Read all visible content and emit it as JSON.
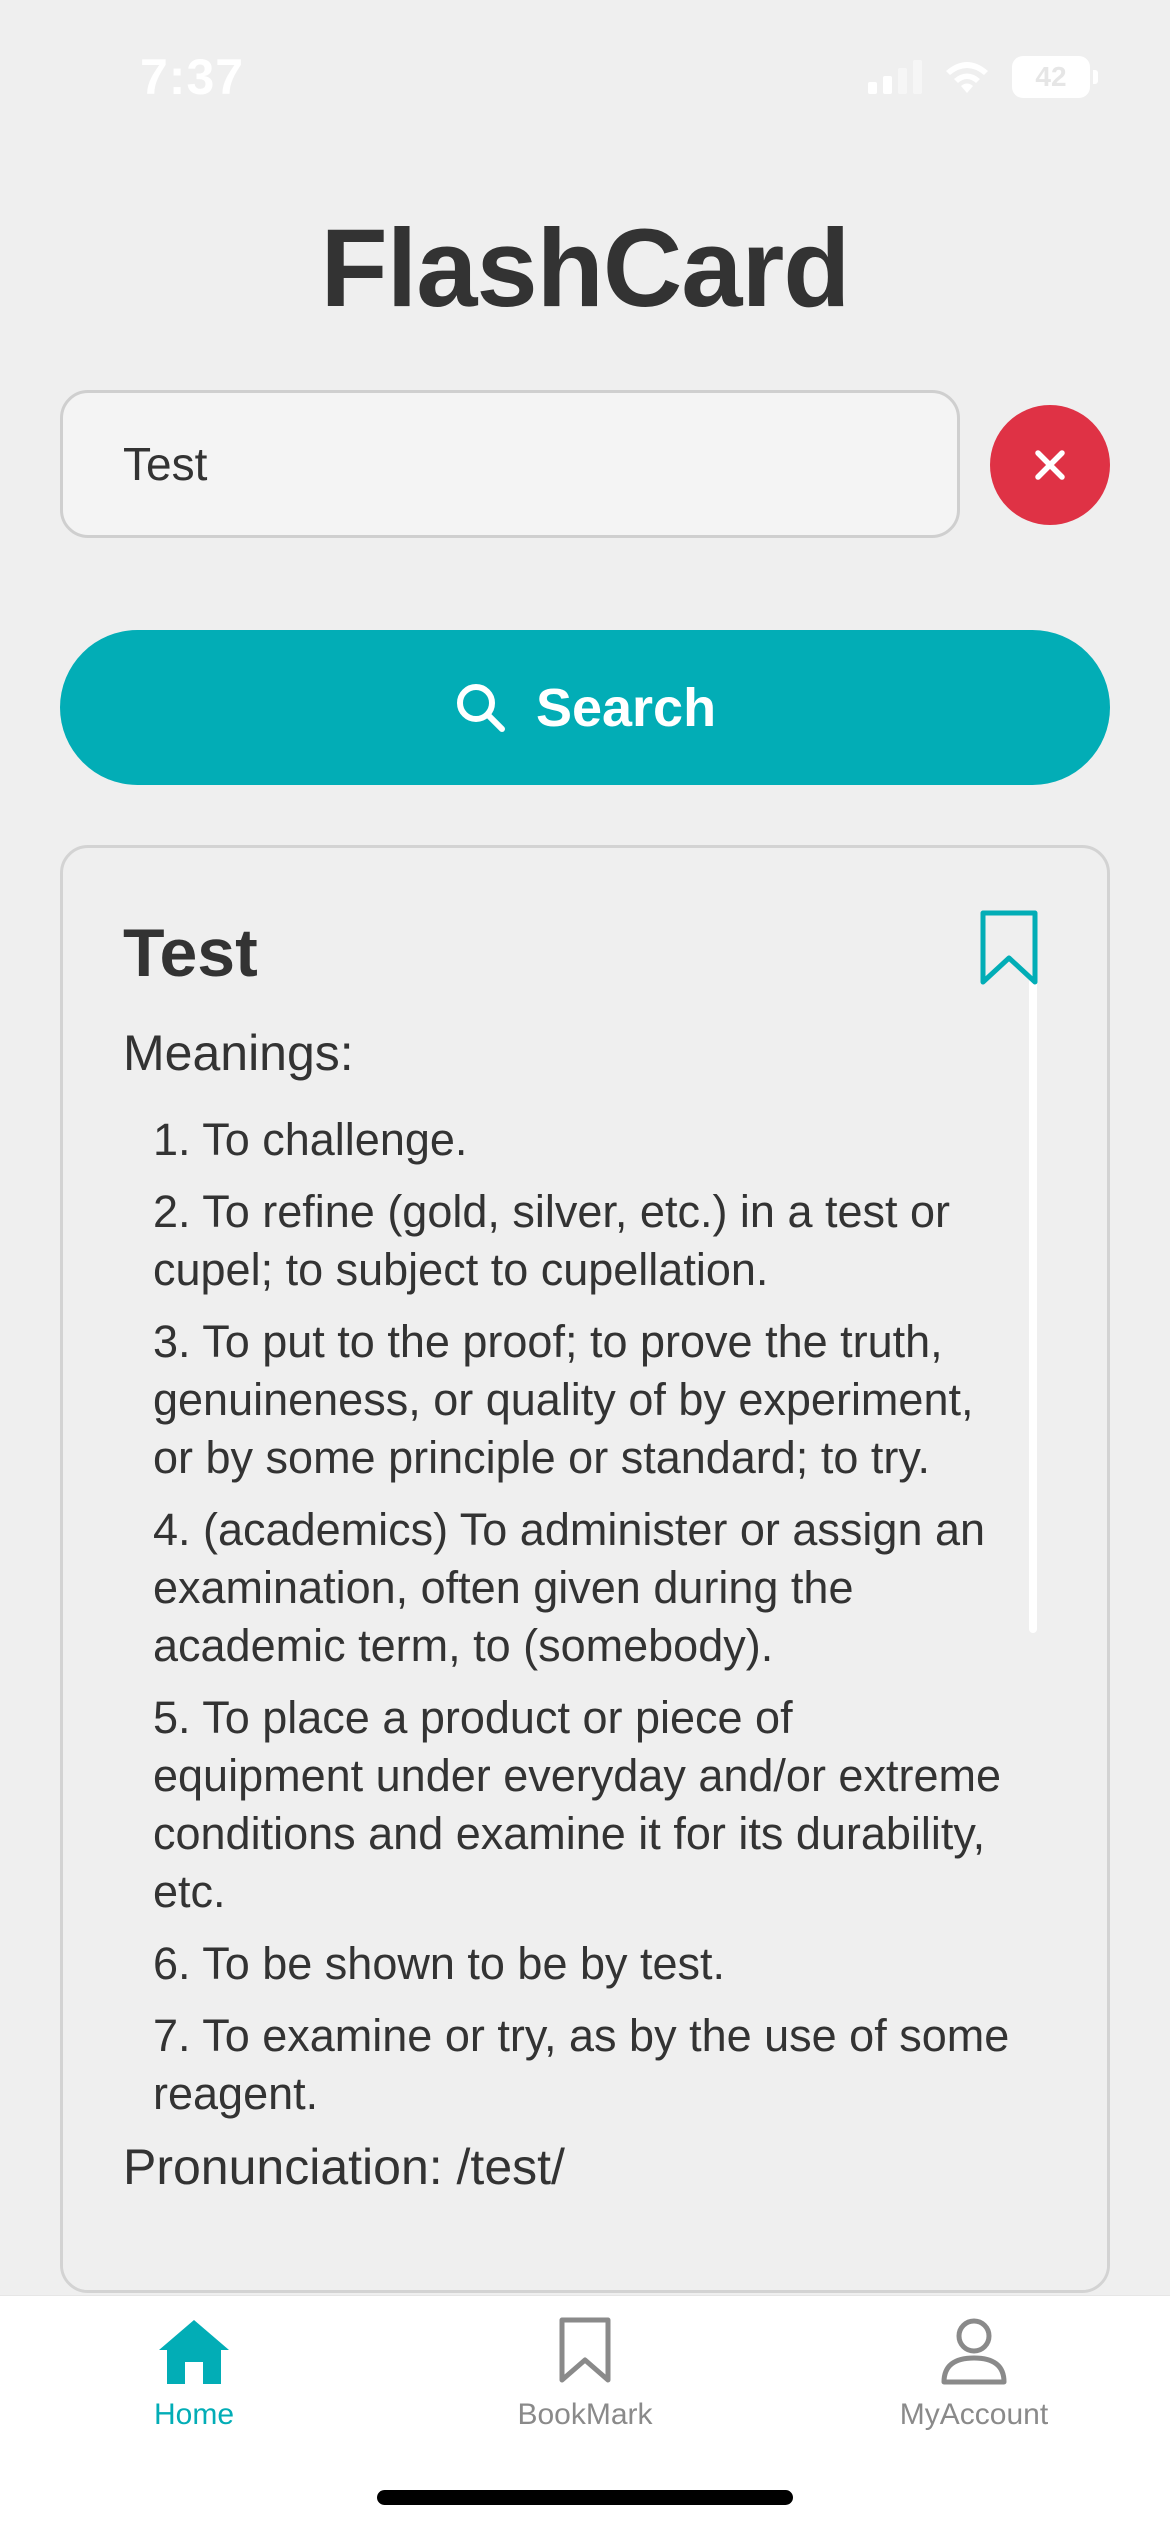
{
  "status_bar": {
    "time": "7:37",
    "battery": "42"
  },
  "app": {
    "title": "FlashCard"
  },
  "search": {
    "value": "Test",
    "button_label": "Search"
  },
  "result": {
    "word": "Test",
    "meanings_label": "Meanings:",
    "meanings": [
      "1. To challenge.",
      "2. To refine (gold, silver, etc.) in a test or cupel; to subject to cupellation.",
      "3. To put to the proof; to prove the truth, genuineness, or quality of by experiment, or by some principle or standard; to try.",
      "4. (academics) To administer or assign an examination, often given during the academic term, to (somebody).",
      "5. To place a product or piece of equipment under everyday and/or extreme conditions and examine it for its durability, etc.",
      "6. To be shown to be by test.",
      "7. To examine or try, as by the use of some reagent."
    ],
    "pronunciation": "Pronunciation: /test/"
  },
  "tabs": [
    {
      "label": "Home",
      "icon": "home-icon",
      "active": true
    },
    {
      "label": "BookMark",
      "icon": "bookmark-icon",
      "active": false
    },
    {
      "label": "MyAccount",
      "icon": "user-icon",
      "active": false
    }
  ],
  "colors": {
    "accent": "#02adb6",
    "danger": "#df3245",
    "text": "#333333",
    "inactive": "#8a8a8a",
    "background": "#efefef"
  }
}
